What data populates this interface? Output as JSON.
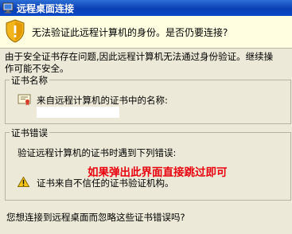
{
  "window": {
    "title": "远程桌面连接"
  },
  "warning_banner": {
    "icon": "shield-warning-icon",
    "message": "无法验证此远程计算机的身份。是否仍要连接?"
  },
  "description": {
    "line1": "由于安全证书存在问题,因此远程计算机无法通过身份验证。继续操",
    "line2": "作可能不安全。"
  },
  "certificate_name_group": {
    "legend": "证书名称",
    "icon": "certificate-icon",
    "label": "来自远程计算机的证书中的名称:",
    "value": ""
  },
  "certificate_errors_group": {
    "legend": "证书错误",
    "intro": "验证远程计算机的证书时遇到下列错误:",
    "errors": [
      {
        "icon": "warning-triangle-icon",
        "text": "证书来自不信任的证书验证机构。"
      }
    ]
  },
  "annotation": {
    "text": "如果弹出此界面直接跳过即可",
    "color": "#e8000f"
  },
  "question": "您想连接到远程桌面而忽略这些证书错误吗?"
}
